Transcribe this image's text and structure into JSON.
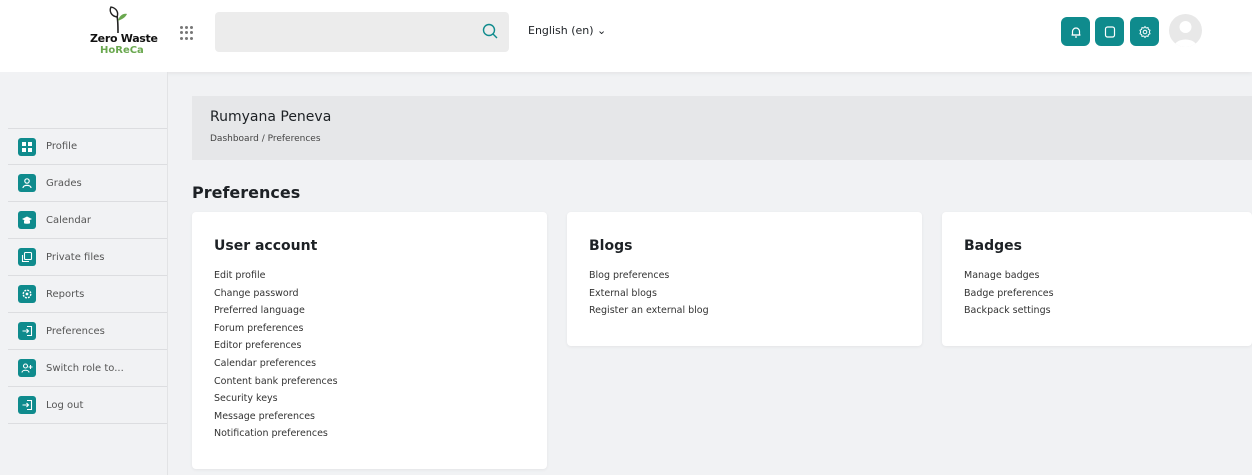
{
  "brand": {
    "line1": "Zero Waste",
    "line2": "HoReCa"
  },
  "search": {
    "placeholder": ""
  },
  "language": {
    "label": "English (en) ⌄"
  },
  "topbar_buttons": [
    {
      "name": "notifications-button",
      "icon": "bell-icon"
    },
    {
      "name": "messages-button",
      "icon": "message-icon"
    },
    {
      "name": "settings-button",
      "icon": "gear-icon"
    }
  ],
  "sidebar": {
    "items": [
      {
        "label": "Profile",
        "icon": "profile-grid-icon"
      },
      {
        "label": "Grades",
        "icon": "person-icon"
      },
      {
        "label": "Calendar",
        "icon": "graduation-cap-icon"
      },
      {
        "label": "Private files",
        "icon": "files-icon"
      },
      {
        "label": "Reports",
        "icon": "cog-icon"
      },
      {
        "label": "Preferences",
        "icon": "sign-in-icon"
      },
      {
        "label": "Switch role to...",
        "icon": "user-plus-icon"
      },
      {
        "label": "Log out",
        "icon": "sign-out-icon"
      }
    ]
  },
  "header": {
    "user_name": "Rumyana Peneva",
    "breadcrumb": "Dashboard / Preferences"
  },
  "page_title": "Preferences",
  "cards": [
    {
      "title": "User account",
      "links": [
        "Edit profile",
        "Change password",
        "Preferred language",
        "Forum preferences",
        "Editor preferences",
        "Calendar preferences",
        "Content bank preferences",
        "Security keys",
        "Message preferences",
        "Notification preferences"
      ]
    },
    {
      "title": "Blogs",
      "links": [
        "Blog preferences",
        "External blogs",
        "Register an external blog"
      ]
    },
    {
      "title": "Badges",
      "links": [
        "Manage badges",
        "Badge preferences",
        "Backpack settings"
      ]
    }
  ],
  "colors": {
    "accent": "#0f8b8d",
    "brand_green": "#6aa84f"
  }
}
